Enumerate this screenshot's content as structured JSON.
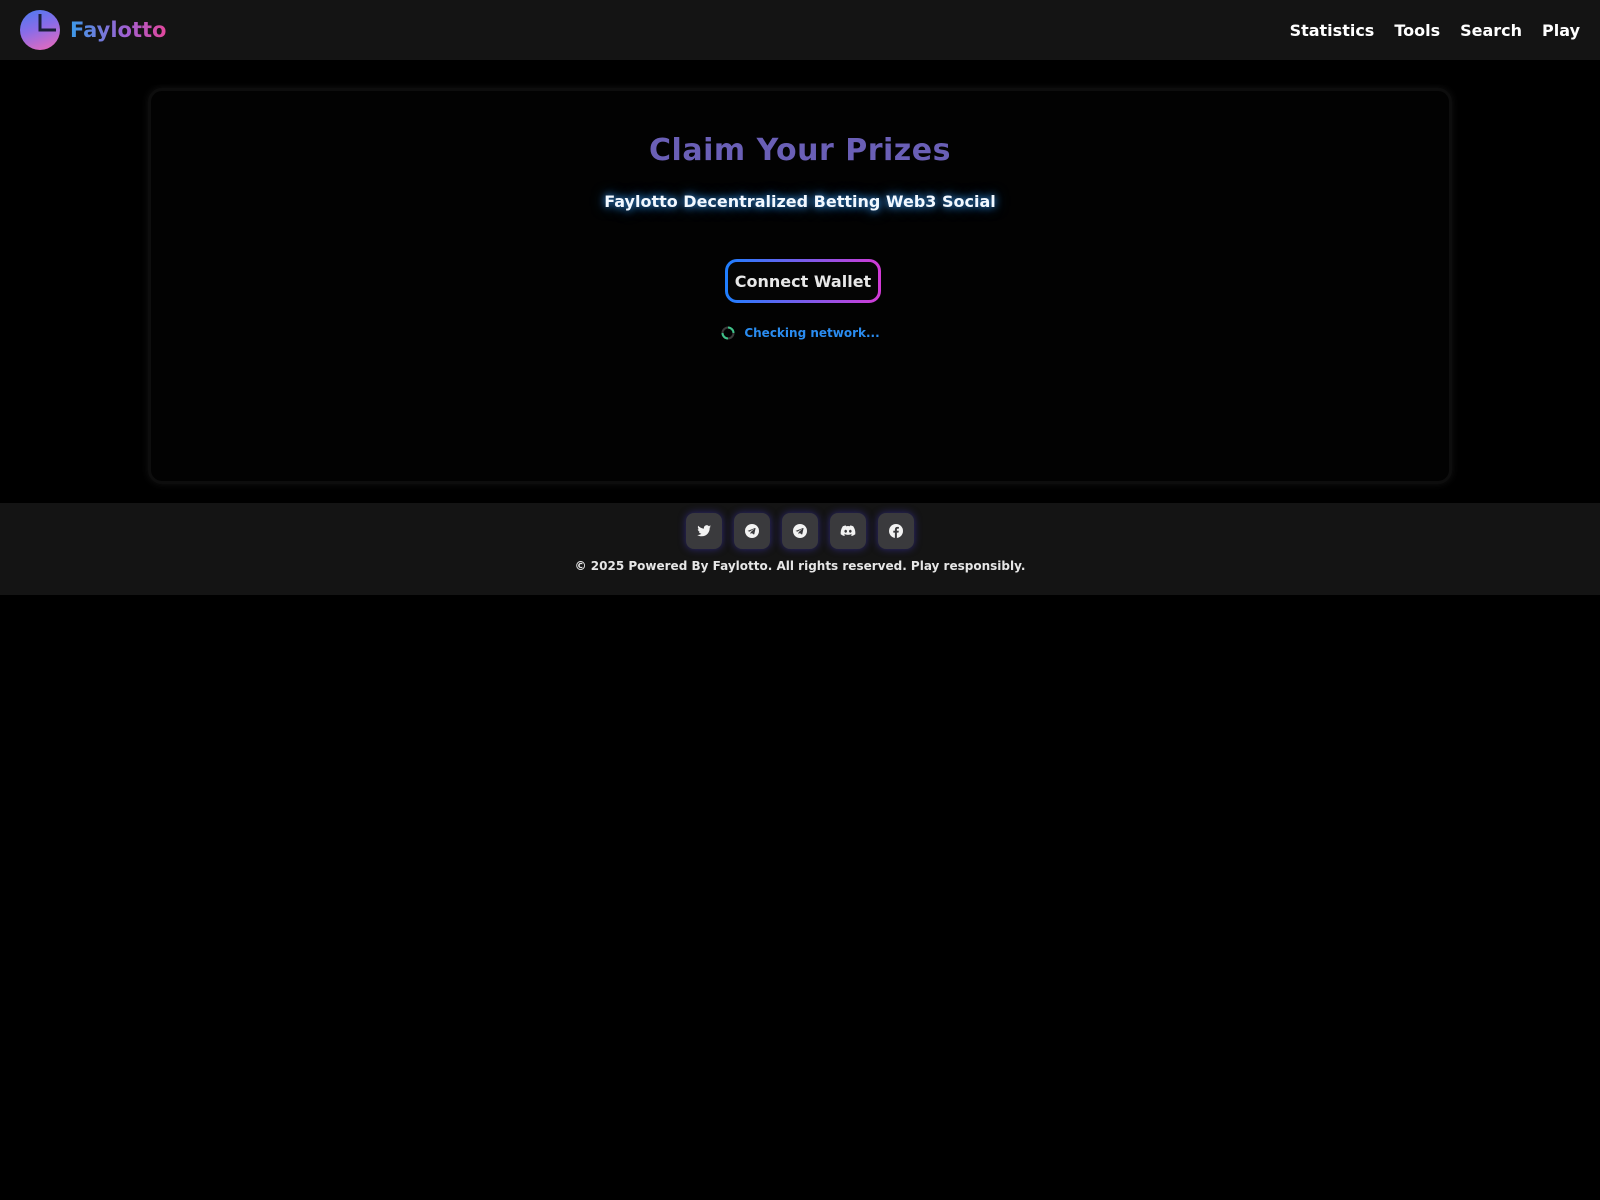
{
  "header": {
    "brand": "Faylotto",
    "nav": [
      {
        "label": "Statistics"
      },
      {
        "label": "Tools"
      },
      {
        "label": "Search"
      },
      {
        "label": "Play"
      }
    ]
  },
  "main": {
    "title": "Claim Your Prizes",
    "subtitle": "Faylotto Decentralized Betting Web3 Social",
    "connect_label": "Connect Wallet",
    "status_text": "Checking network..."
  },
  "footer": {
    "socials": [
      {
        "icon": "twitter-icon"
      },
      {
        "icon": "telegram-icon"
      },
      {
        "icon": "telegram-icon"
      },
      {
        "icon": "discord-icon"
      },
      {
        "icon": "facebook-icon"
      }
    ],
    "copyright": "© 2025 Powered By Faylotto. All rights reserved. Play responsibly."
  },
  "colors": {
    "accent_blue": "#1e7fff",
    "accent_pink": "#d23ad6",
    "title_purple": "#6a5fb6",
    "status_blue": "#2a8cf0"
  }
}
